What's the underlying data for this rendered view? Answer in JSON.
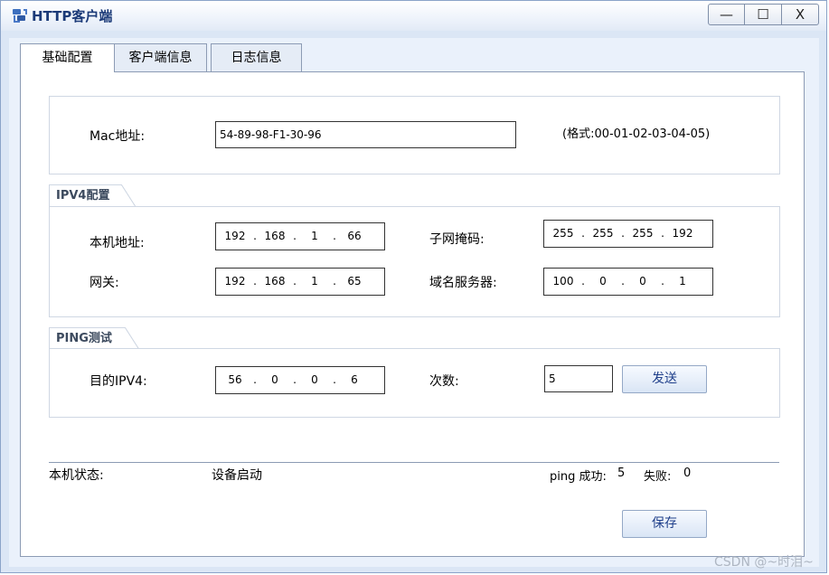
{
  "window": {
    "title": "HTTP客户端",
    "minimize_glyph": "—",
    "maximize_glyph": "☐",
    "close_glyph": "X"
  },
  "tabs": [
    {
      "label": "基础配置",
      "active": true
    },
    {
      "label": "客户端信息",
      "active": false
    },
    {
      "label": "日志信息",
      "active": false
    }
  ],
  "mac": {
    "label": "Mac地址:",
    "value": "54-89-98-F1-30-96",
    "format_hint": "(格式:00-01-02-03-04-05)"
  },
  "ipv4": {
    "legend": "IPV4配置",
    "local_address": {
      "label": "本机地址:",
      "octets": [
        "192",
        "168",
        "1",
        "66"
      ]
    },
    "subnet_mask": {
      "label": "子网掩码:",
      "octets": [
        "255",
        "255",
        "255",
        "192"
      ]
    },
    "gateway": {
      "label": "网关:",
      "octets": [
        "192",
        "168",
        "1",
        "65"
      ]
    },
    "dns_server": {
      "label": "域名服务器:",
      "octets": [
        "100",
        "0",
        "0",
        "1"
      ]
    }
  },
  "ping": {
    "legend": "PING测试",
    "target": {
      "label": "目的IPV4:",
      "octets": [
        "56",
        "0",
        "0",
        "6"
      ]
    },
    "count": {
      "label": "次数:",
      "value": "5"
    },
    "send_label": "发送"
  },
  "status": {
    "label": "本机状态:",
    "value": "设备启动",
    "ping_success_label": "ping 成功:",
    "ping_success_value": "5",
    "ping_fail_label": "失败:",
    "ping_fail_value": "0"
  },
  "save_label": "保存",
  "watermark": "CSDN @~时泪~",
  "colors": {
    "accent": "#1b3a78",
    "panel_border": "#8c9bb4",
    "window_bg": "#dbe6f5"
  }
}
